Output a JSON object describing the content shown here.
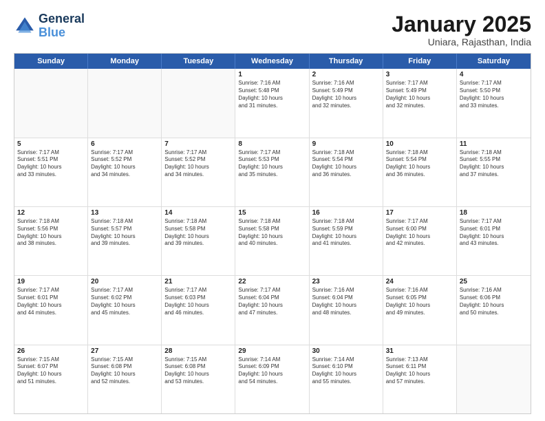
{
  "logo": {
    "line1": "General",
    "line2": "Blue"
  },
  "title": "January 2025",
  "subtitle": "Uniara, Rajasthan, India",
  "header_days": [
    "Sunday",
    "Monday",
    "Tuesday",
    "Wednesday",
    "Thursday",
    "Friday",
    "Saturday"
  ],
  "weeks": [
    [
      {
        "day": "",
        "info": ""
      },
      {
        "day": "",
        "info": ""
      },
      {
        "day": "",
        "info": ""
      },
      {
        "day": "1",
        "info": "Sunrise: 7:16 AM\nSunset: 5:48 PM\nDaylight: 10 hours\nand 31 minutes."
      },
      {
        "day": "2",
        "info": "Sunrise: 7:16 AM\nSunset: 5:49 PM\nDaylight: 10 hours\nand 32 minutes."
      },
      {
        "day": "3",
        "info": "Sunrise: 7:17 AM\nSunset: 5:49 PM\nDaylight: 10 hours\nand 32 minutes."
      },
      {
        "day": "4",
        "info": "Sunrise: 7:17 AM\nSunset: 5:50 PM\nDaylight: 10 hours\nand 33 minutes."
      }
    ],
    [
      {
        "day": "5",
        "info": "Sunrise: 7:17 AM\nSunset: 5:51 PM\nDaylight: 10 hours\nand 33 minutes."
      },
      {
        "day": "6",
        "info": "Sunrise: 7:17 AM\nSunset: 5:52 PM\nDaylight: 10 hours\nand 34 minutes."
      },
      {
        "day": "7",
        "info": "Sunrise: 7:17 AM\nSunset: 5:52 PM\nDaylight: 10 hours\nand 34 minutes."
      },
      {
        "day": "8",
        "info": "Sunrise: 7:17 AM\nSunset: 5:53 PM\nDaylight: 10 hours\nand 35 minutes."
      },
      {
        "day": "9",
        "info": "Sunrise: 7:18 AM\nSunset: 5:54 PM\nDaylight: 10 hours\nand 36 minutes."
      },
      {
        "day": "10",
        "info": "Sunrise: 7:18 AM\nSunset: 5:54 PM\nDaylight: 10 hours\nand 36 minutes."
      },
      {
        "day": "11",
        "info": "Sunrise: 7:18 AM\nSunset: 5:55 PM\nDaylight: 10 hours\nand 37 minutes."
      }
    ],
    [
      {
        "day": "12",
        "info": "Sunrise: 7:18 AM\nSunset: 5:56 PM\nDaylight: 10 hours\nand 38 minutes."
      },
      {
        "day": "13",
        "info": "Sunrise: 7:18 AM\nSunset: 5:57 PM\nDaylight: 10 hours\nand 39 minutes."
      },
      {
        "day": "14",
        "info": "Sunrise: 7:18 AM\nSunset: 5:58 PM\nDaylight: 10 hours\nand 39 minutes."
      },
      {
        "day": "15",
        "info": "Sunrise: 7:18 AM\nSunset: 5:58 PM\nDaylight: 10 hours\nand 40 minutes."
      },
      {
        "day": "16",
        "info": "Sunrise: 7:18 AM\nSunset: 5:59 PM\nDaylight: 10 hours\nand 41 minutes."
      },
      {
        "day": "17",
        "info": "Sunrise: 7:17 AM\nSunset: 6:00 PM\nDaylight: 10 hours\nand 42 minutes."
      },
      {
        "day": "18",
        "info": "Sunrise: 7:17 AM\nSunset: 6:01 PM\nDaylight: 10 hours\nand 43 minutes."
      }
    ],
    [
      {
        "day": "19",
        "info": "Sunrise: 7:17 AM\nSunset: 6:01 PM\nDaylight: 10 hours\nand 44 minutes."
      },
      {
        "day": "20",
        "info": "Sunrise: 7:17 AM\nSunset: 6:02 PM\nDaylight: 10 hours\nand 45 minutes."
      },
      {
        "day": "21",
        "info": "Sunrise: 7:17 AM\nSunset: 6:03 PM\nDaylight: 10 hours\nand 46 minutes."
      },
      {
        "day": "22",
        "info": "Sunrise: 7:17 AM\nSunset: 6:04 PM\nDaylight: 10 hours\nand 47 minutes."
      },
      {
        "day": "23",
        "info": "Sunrise: 7:16 AM\nSunset: 6:04 PM\nDaylight: 10 hours\nand 48 minutes."
      },
      {
        "day": "24",
        "info": "Sunrise: 7:16 AM\nSunset: 6:05 PM\nDaylight: 10 hours\nand 49 minutes."
      },
      {
        "day": "25",
        "info": "Sunrise: 7:16 AM\nSunset: 6:06 PM\nDaylight: 10 hours\nand 50 minutes."
      }
    ],
    [
      {
        "day": "26",
        "info": "Sunrise: 7:15 AM\nSunset: 6:07 PM\nDaylight: 10 hours\nand 51 minutes."
      },
      {
        "day": "27",
        "info": "Sunrise: 7:15 AM\nSunset: 6:08 PM\nDaylight: 10 hours\nand 52 minutes."
      },
      {
        "day": "28",
        "info": "Sunrise: 7:15 AM\nSunset: 6:08 PM\nDaylight: 10 hours\nand 53 minutes."
      },
      {
        "day": "29",
        "info": "Sunrise: 7:14 AM\nSunset: 6:09 PM\nDaylight: 10 hours\nand 54 minutes."
      },
      {
        "day": "30",
        "info": "Sunrise: 7:14 AM\nSunset: 6:10 PM\nDaylight: 10 hours\nand 55 minutes."
      },
      {
        "day": "31",
        "info": "Sunrise: 7:13 AM\nSunset: 6:11 PM\nDaylight: 10 hours\nand 57 minutes."
      },
      {
        "day": "",
        "info": ""
      }
    ]
  ]
}
